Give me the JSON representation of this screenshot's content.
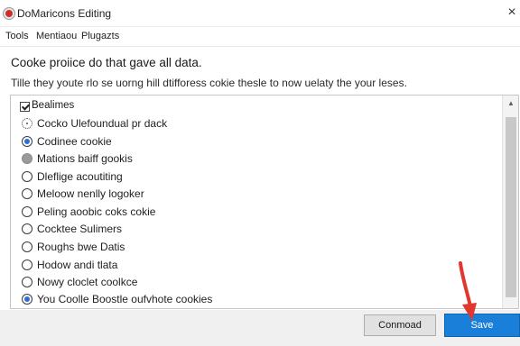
{
  "window": {
    "title": "DoMaricons Editing",
    "close_glyph": "×"
  },
  "menu": {
    "items": [
      "Tools",
      "Mentiaou",
      "Plugazts"
    ]
  },
  "main": {
    "heading": "Cooke proiice do that gave all data.",
    "subtext": "Tille they youte rlo se uorng hill dtifforess cokie thesle to now uelaty the your leses."
  },
  "list": {
    "header": "Bealimes",
    "rows": [
      {
        "label": "Cocko Ulefoundual pr dack",
        "state": "dotted"
      },
      {
        "label": "Codinee cookie",
        "state": "checked"
      },
      {
        "label": "Mations baiff gookis",
        "state": "gray"
      },
      {
        "label": "Dleflige acoutiting",
        "state": "empty"
      },
      {
        "label": "Meloow nenlly logoker",
        "state": "empty"
      },
      {
        "label": "Peling aoobic coks cokie",
        "state": "empty"
      },
      {
        "label": "Cocktee Sulimers",
        "state": "empty"
      },
      {
        "label": "Roughs bwe Datis",
        "state": "empty"
      },
      {
        "label": "Hodow andi tlata",
        "state": "empty"
      },
      {
        "label": "Nowy cloclet coolkce",
        "state": "empty"
      },
      {
        "label": "You Coolle Boostle oufvhote cookies",
        "state": "checked"
      }
    ]
  },
  "footer": {
    "cancel_label": "Conmoad",
    "save_label": "Save"
  },
  "colors": {
    "accent": "#1a7fd9",
    "radio_selected": "#2a6fd6",
    "annotation_arrow": "#e0372f"
  },
  "icons": {
    "app": "app-logo-icon",
    "close": "close-icon",
    "scroll_up": "scroll-up-icon",
    "annotation": "red-arrow-icon"
  }
}
